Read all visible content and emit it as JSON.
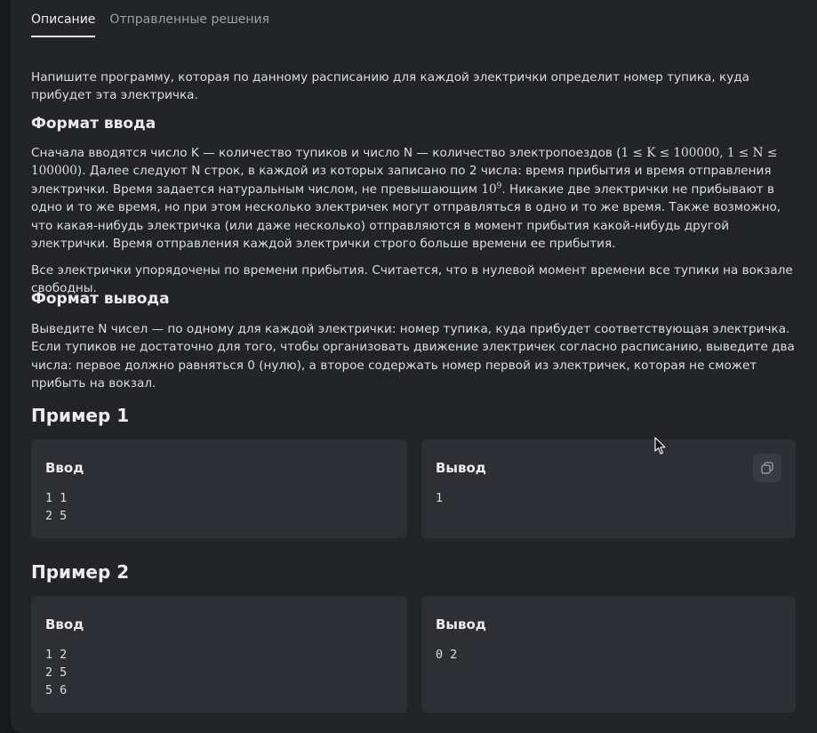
{
  "tabs": [
    {
      "label": "Описание",
      "active": true
    },
    {
      "label": "Отправленные решения",
      "active": false
    }
  ],
  "intro": "Напишите программу, которая по данному расписанию для каждой электрички определит номер тупика, куда прибудет эта электричка.",
  "input_format": {
    "heading": "Формат ввода",
    "p1_a": "Сначала вводятся число K — количество тупиков и число N — количество электропоездов (",
    "p1_constraints": "1 ≤ K ≤ 100000, 1 ≤ N ≤ 100000",
    "p1_b": "). Далее следуют N строк, в каждой из которых записано по 2 числа: время прибытия и время отправления электрички. Время задается натуральным числом, не превышающим ",
    "p1_pow_base": "10",
    "p1_pow_exp": "9",
    "p1_c": ". Никакие две электрички не прибывают в одно и то же время, но при этом несколько электричек могут отправляться в одно и то же время. Также возможно, что какая-нибудь электричка (или даже несколько) отправляются в момент прибытия какой-нибудь другой электрички. Время отправления каждой электрички строго больше времени ее прибытия.",
    "p2": "Все электрички упорядочены по времени прибытия. Считается, что в нулевой момент времени все тупики на вокзале свободны."
  },
  "output_format": {
    "heading": "Формат вывода",
    "text": "Выведите N чисел — по одному для каждой электрички: номер тупика, куда прибудет соответствующая электричка. Если тупиков не достаточно для того, чтобы организовать движение электричек согласно расписанию, выведите два числа: первое должно равняться 0 (нулю), а второе содержать номер первой из электричек, которая не сможет прибыть на вокзал."
  },
  "examples": [
    {
      "title": "Пример 1",
      "input_label": "Ввод",
      "input": "1 1\n2 5",
      "output_label": "Вывод",
      "output": "1"
    },
    {
      "title": "Пример 2",
      "input_label": "Ввод",
      "input": "1 2\n2 5\n5 6",
      "output_label": "Вывод",
      "output": "0 2"
    }
  ],
  "icons": {
    "copy": "copy-icon",
    "cursor": "mouse-pointer-icon"
  },
  "colors": {
    "background": "#17181b",
    "panel": "#232428",
    "card": "#2e2f34",
    "text": "#dcdde0",
    "muted": "#9aa0a8"
  }
}
